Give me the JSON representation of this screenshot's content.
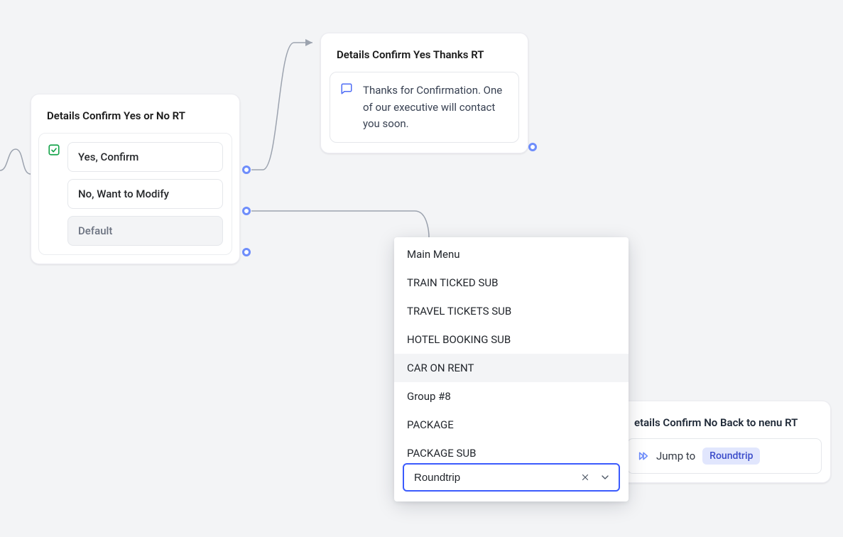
{
  "nodes": {
    "decision": {
      "title": "Details Confirm Yes or No RT",
      "options": {
        "yes": "Yes, Confirm",
        "no": "No, Want to Modify",
        "default": "Default"
      }
    },
    "thanks": {
      "title": "Details Confirm Yes Thanks RT",
      "message": "Thanks for Confirmation. One of our executive will contact you soon."
    },
    "noback": {
      "title": "etails Confirm No Back to nenu RT",
      "jump_label": "Jump to",
      "jump_target": "Roundtrip"
    }
  },
  "dropdown": {
    "input_value": "Roundtrip",
    "options": [
      "Main Menu",
      "TRAIN TICKED SUB",
      "TRAVEL TICKETS SUB",
      "HOTEL BOOKING SUB",
      "CAR ON RENT",
      "Group #8",
      "PACKAGE",
      "PACKAGE SUB"
    ],
    "highlighted_index": 4
  }
}
